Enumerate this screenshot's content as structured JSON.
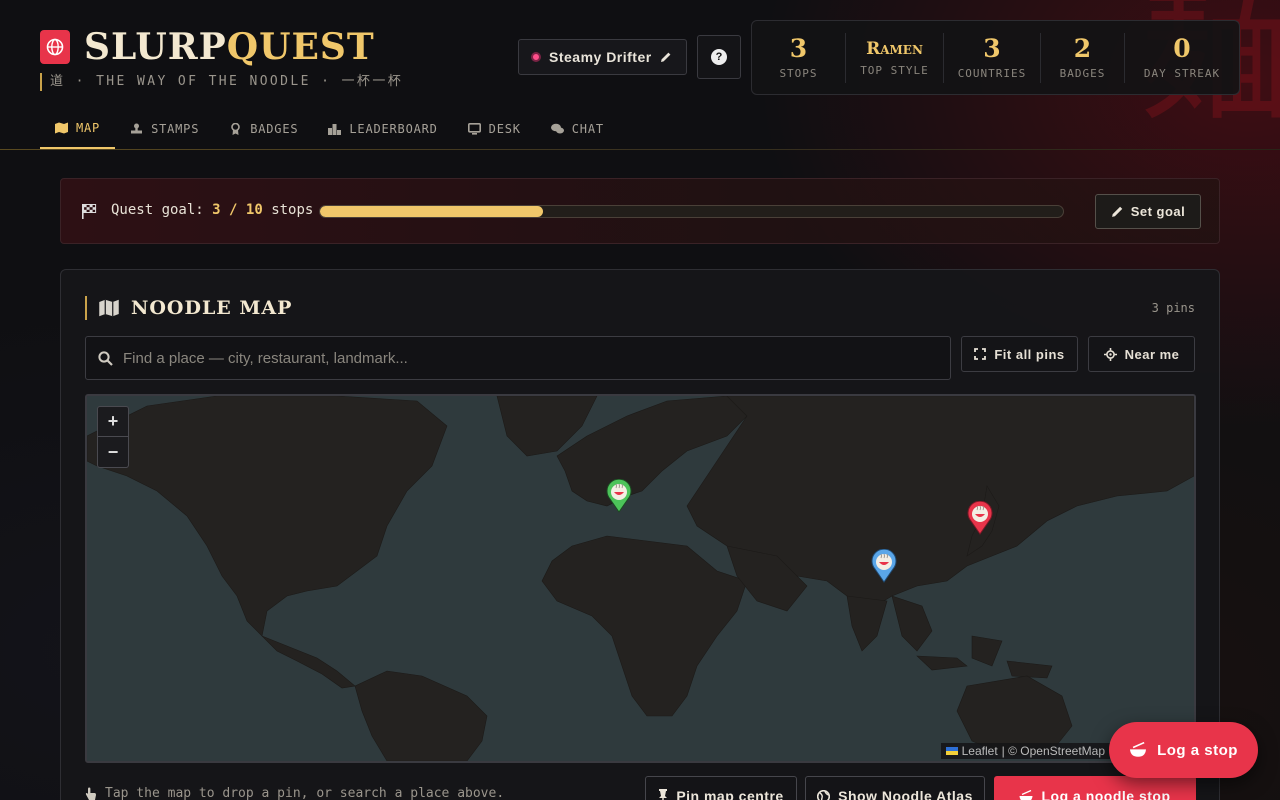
{
  "brand": {
    "title_main": "SLURP",
    "title_accent": "QUEST",
    "tagline": "道 · THE WAY OF THE NOODLE · 一杯一杯",
    "watermark": "麺"
  },
  "user": {
    "name": "Steamy Drifter"
  },
  "stats": [
    {
      "value": "3",
      "label": "Stops"
    },
    {
      "value": "Ramen",
      "label": "Top Style"
    },
    {
      "value": "3",
      "label": "Countries"
    },
    {
      "value": "2",
      "label": "Badges"
    },
    {
      "value": "0",
      "label": "Day Streak"
    }
  ],
  "nav": [
    {
      "label": "MAP",
      "icon": "map-icon",
      "active": true
    },
    {
      "label": "STAMPS",
      "icon": "stamp-icon"
    },
    {
      "label": "BADGES",
      "icon": "badge-icon"
    },
    {
      "label": "LEADERBOARD",
      "icon": "podium-icon"
    },
    {
      "label": "DESK",
      "icon": "monitor-icon"
    },
    {
      "label": "CHAT",
      "icon": "chat-icon"
    }
  ],
  "quest": {
    "prefix": "Quest goal:",
    "current": "3",
    "separator": "/",
    "target": "10",
    "suffix": "stops",
    "progress_fraction": 0.3,
    "set_goal_label": "Set goal"
  },
  "map_panel": {
    "title": "NOODLE MAP",
    "pins_count": "3 pins",
    "search_placeholder": "Find a place — city, restaurant, landmark...",
    "fit_label": "Fit all pins",
    "near_label": "Near me",
    "zoom_in": "+",
    "zoom_out": "−",
    "attribution_leaflet": "Leaflet",
    "attribution_osm": "| © OpenStreetMap",
    "hint": "Tap the map to drop a pin, or search a place above.",
    "pin_centre_label": "Pin map centre",
    "atlas_label": "Show Noodle Atlas",
    "log_label": "Log a noodle stop",
    "pins": [
      {
        "region": "europe",
        "color": "#4cc35a"
      },
      {
        "region": "southeast-asia",
        "color": "#5aa6e8"
      },
      {
        "region": "japan",
        "color": "#e8344a"
      }
    ]
  },
  "fab": {
    "label": "Log a stop"
  },
  "colors": {
    "accent": "#f0c76a",
    "brand": "#e8344a",
    "bg": "#0f0f12"
  }
}
